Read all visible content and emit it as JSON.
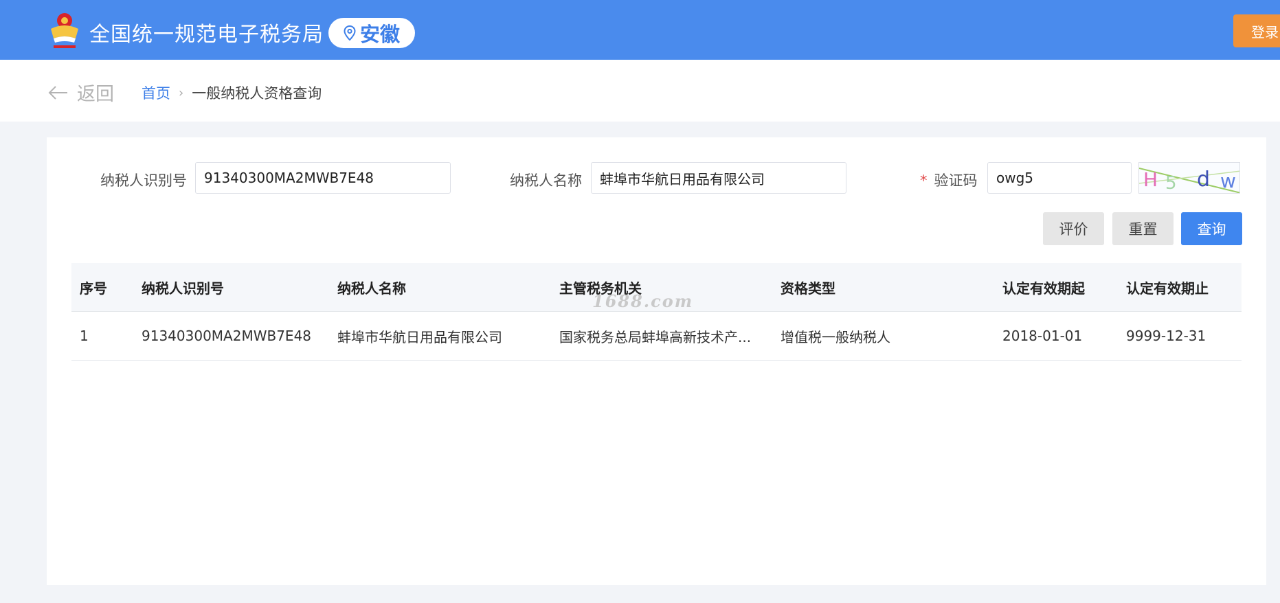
{
  "header": {
    "site_title": "全国统一规范电子税务局",
    "region": "安徽",
    "login_label": "登录",
    "emblem_icon": "tax-emblem-icon",
    "region_icon": "location-pin-icon"
  },
  "breadcrumb": {
    "back_label": "返回",
    "home": "首页",
    "separator": "›",
    "current": "一般纳税人资格查询"
  },
  "form": {
    "taxpayer_id_label": "纳税人识别号",
    "taxpayer_id_value": "91340300MA2MWB7E48",
    "taxpayer_name_label": "纳税人名称",
    "taxpayer_name_value": "蚌埠市华航日用品有限公司",
    "captcha_required_mark": "*",
    "captcha_label": "验证码",
    "captcha_value": "owg5",
    "captcha_image_text": "H5dw"
  },
  "buttons": {
    "evaluate": "评价",
    "reset": "重置",
    "query": "查询"
  },
  "table": {
    "headers": [
      "序号",
      "纳税人识别号",
      "纳税人名称",
      "主管税务机关",
      "资格类型",
      "认定有效期起",
      "认定有效期止"
    ],
    "rows": [
      [
        "1",
        "91340300MA2MWB7E48",
        "蚌埠市华航日用品有限公司",
        "国家税务总局蚌埠高新技术产...",
        "增值税一般纳税人",
        "2018-01-01",
        "9999-12-31"
      ]
    ]
  },
  "watermark": "1688.com",
  "colors": {
    "header_bg": "#4a8bed",
    "primary": "#3f86ef",
    "login_orange": "#f0923a"
  }
}
